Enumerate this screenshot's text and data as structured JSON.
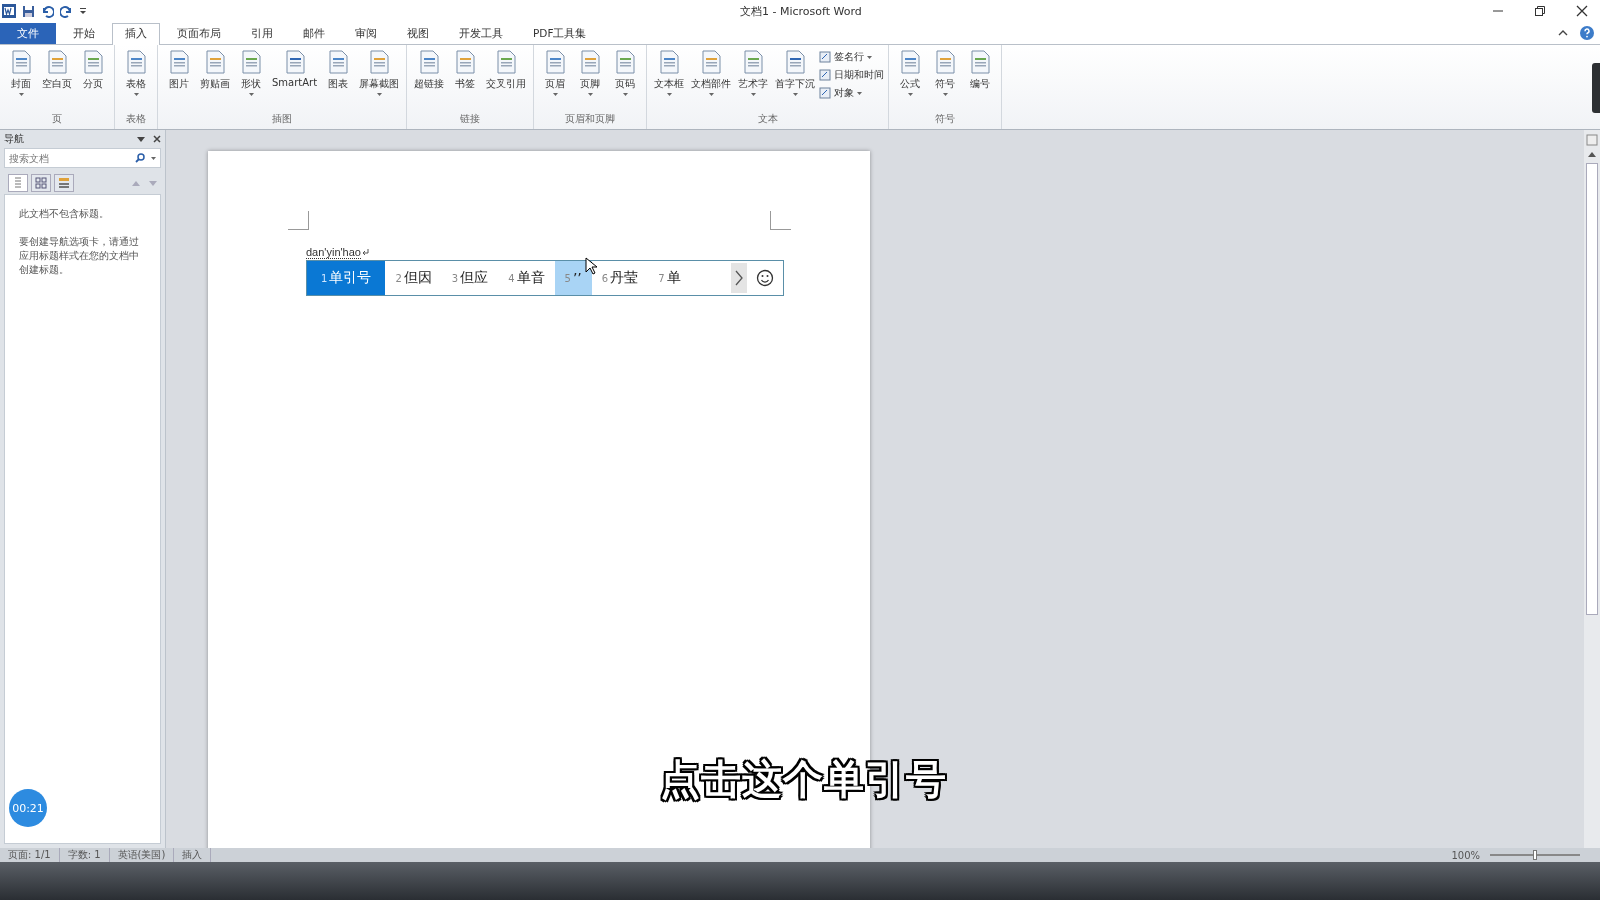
{
  "window": {
    "title": "文档1 - Microsoft Word"
  },
  "tabs": [
    {
      "label": "文件",
      "kind": "file",
      "selected": false
    },
    {
      "label": "开始",
      "kind": "tab",
      "selected": false
    },
    {
      "label": "插入",
      "kind": "tab",
      "selected": true
    },
    {
      "label": "页面布局",
      "kind": "tab",
      "selected": false
    },
    {
      "label": "引用",
      "kind": "tab",
      "selected": false
    },
    {
      "label": "邮件",
      "kind": "tab",
      "selected": false
    },
    {
      "label": "审阅",
      "kind": "tab",
      "selected": false
    },
    {
      "label": "视图",
      "kind": "tab",
      "selected": false
    },
    {
      "label": "开发工具",
      "kind": "tab",
      "selected": false
    },
    {
      "label": "PDF工具集",
      "kind": "tab",
      "selected": false
    }
  ],
  "ribbon_groups": [
    {
      "label": "页",
      "items": [
        {
          "label": "封面",
          "kind": "large",
          "dropdown": true
        },
        {
          "label": "空白页",
          "kind": "large",
          "dropdown": false
        },
        {
          "label": "分页",
          "kind": "large",
          "dropdown": false
        }
      ]
    },
    {
      "label": "表格",
      "items": [
        {
          "label": "表格",
          "kind": "large",
          "dropdown": true
        }
      ]
    },
    {
      "label": "插图",
      "items": [
        {
          "label": "图片",
          "kind": "large",
          "dropdown": false
        },
        {
          "label": "剪贴画",
          "kind": "large",
          "dropdown": false
        },
        {
          "label": "形状",
          "kind": "large",
          "dropdown": true
        },
        {
          "label": "SmartArt",
          "kind": "large",
          "dropdown": false
        },
        {
          "label": "图表",
          "kind": "large",
          "dropdown": false
        },
        {
          "label": "屏幕截图",
          "kind": "large",
          "dropdown": true
        }
      ]
    },
    {
      "label": "链接",
      "items": [
        {
          "label": "超链接",
          "kind": "large",
          "dropdown": false
        },
        {
          "label": "书签",
          "kind": "large",
          "dropdown": false
        },
        {
          "label": "交叉引用",
          "kind": "large",
          "dropdown": false
        }
      ]
    },
    {
      "label": "页眉和页脚",
      "items": [
        {
          "label": "页眉",
          "kind": "large",
          "dropdown": true
        },
        {
          "label": "页脚",
          "kind": "large",
          "dropdown": true
        },
        {
          "label": "页码",
          "kind": "large",
          "dropdown": true
        }
      ]
    },
    {
      "label": "文本",
      "items": [
        {
          "label": "文本框",
          "kind": "large",
          "dropdown": true
        },
        {
          "label": "文档部件",
          "kind": "large",
          "dropdown": true
        },
        {
          "label": "艺术字",
          "kind": "large",
          "dropdown": true
        },
        {
          "label": "首字下沉",
          "kind": "large",
          "dropdown": true
        },
        {
          "label": "签名行",
          "kind": "small",
          "dropdown": true
        },
        {
          "label": "日期和时间",
          "kind": "small",
          "dropdown": false
        },
        {
          "label": "对象",
          "kind": "small",
          "dropdown": true
        }
      ]
    },
    {
      "label": "符号",
      "items": [
        {
          "label": "公式",
          "kind": "large",
          "dropdown": true
        },
        {
          "label": "符号",
          "kind": "large",
          "dropdown": true
        },
        {
          "label": "编号",
          "kind": "large",
          "dropdown": false
        }
      ]
    }
  ],
  "nav_pane": {
    "title": "导航",
    "search": {
      "placeholder": "搜索文档"
    },
    "messages": [
      "此文档不包含标题。",
      "要创建导航选项卡，请通过应用标题样式在您的文档中创建标题。"
    ]
  },
  "document": {
    "typed_text": "dan'yin'hao",
    "candidates": [
      {
        "number": "1",
        "text": "单引号",
        "selected": true,
        "hovered": false
      },
      {
        "number": "2",
        "text": "但因",
        "selected": false,
        "hovered": false
      },
      {
        "number": "3",
        "text": "但应",
        "selected": false,
        "hovered": false
      },
      {
        "number": "4",
        "text": "单音",
        "selected": false,
        "hovered": false
      },
      {
        "number": "5",
        "text": "’’",
        "selected": false,
        "hovered": true
      },
      {
        "number": "6",
        "text": "丹莹",
        "selected": false,
        "hovered": false
      },
      {
        "number": "7",
        "text": "单",
        "selected": false,
        "hovered": false
      }
    ]
  },
  "subtitle": "点击这个单引号",
  "timer": "00:21",
  "status_bar": {
    "items": [
      "页面: 1/1",
      "字数: 1",
      "英语(美国)",
      "插入"
    ],
    "zoom": "100%",
    "zoom_slider": {
      "level": 0.5
    }
  }
}
